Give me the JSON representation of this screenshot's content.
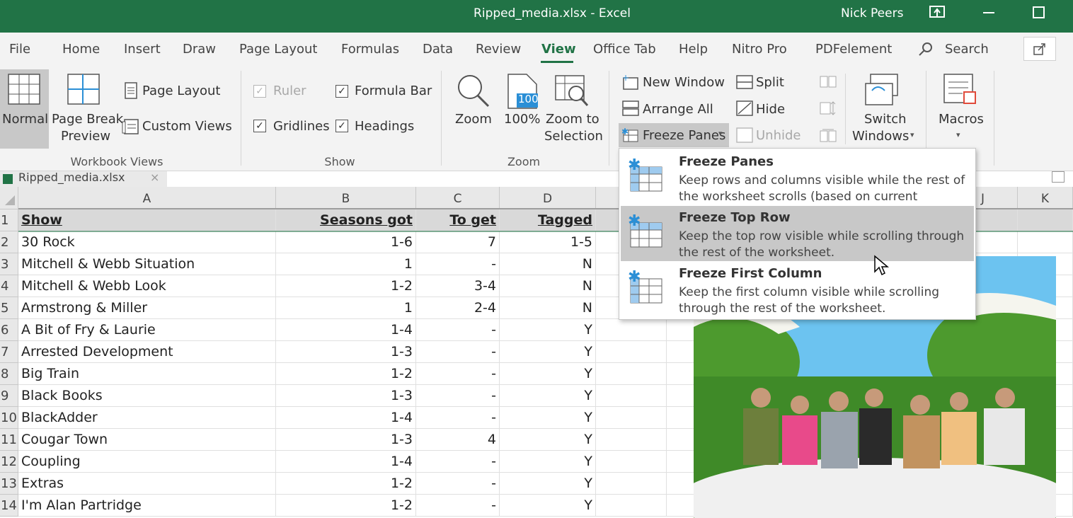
{
  "titlebar": {
    "title": "Ripped_media.xlsx - Excel",
    "user": "Nick Peers"
  },
  "menu": {
    "tabs": [
      "File",
      "Home",
      "Insert",
      "Draw",
      "Page Layout",
      "Formulas",
      "Data",
      "Review",
      "View",
      "Office Tab",
      "Help",
      "Nitro Pro",
      "PDFelement"
    ],
    "active": "View",
    "search": "Search"
  },
  "ribbon": {
    "workbook_views": {
      "normal": "Normal",
      "page_break_1": "Page Break",
      "page_break_2": "Preview",
      "page_layout": "Page Layout",
      "custom_views": "Custom Views",
      "group": "Workbook Views"
    },
    "show": {
      "ruler": "Ruler",
      "formula_bar": "Formula Bar",
      "gridlines": "Gridlines",
      "headings": "Headings",
      "group": "Show"
    },
    "zoom": {
      "zoom": "Zoom",
      "hundred": "100%",
      "hundred_icon": "100",
      "zoom_sel_1": "Zoom to",
      "zoom_sel_2": "Selection",
      "group": "Zoom"
    },
    "window": {
      "new_window": "New Window",
      "arrange_all": "Arrange All",
      "freeze_panes": "Freeze Panes",
      "split": "Split",
      "hide": "Hide",
      "unhide": "Unhide",
      "switch_1": "Switch",
      "switch_2": "Windows",
      "group_partial": "s"
    },
    "macros": {
      "label": "Macros"
    }
  },
  "doc_tab": "Ripped_media.xlsx",
  "sheet": {
    "columns": [
      "A",
      "B",
      "C",
      "D",
      "J",
      "K"
    ],
    "rows": [
      {
        "n": "1",
        "show": "Show",
        "seasons": "Seasons got",
        "to_get": "To get",
        "tagged": "Tagged"
      },
      {
        "n": "2",
        "show": "30 Rock",
        "seasons": "1-6",
        "to_get": "7",
        "tagged": "1-5"
      },
      {
        "n": "3",
        "show": "Mitchell & Webb Situation",
        "seasons": "1",
        "to_get": "-",
        "tagged": "N"
      },
      {
        "n": "4",
        "show": "Mitchell & Webb Look",
        "seasons": "1-2",
        "to_get": "3-4",
        "tagged": "N"
      },
      {
        "n": "5",
        "show": "Armstrong & Miller",
        "seasons": "1",
        "to_get": "2-4",
        "tagged": "N"
      },
      {
        "n": "6",
        "show": "A Bit of Fry & Laurie",
        "seasons": "1-4",
        "to_get": "-",
        "tagged": "Y"
      },
      {
        "n": "7",
        "show": "Arrested Development",
        "seasons": "1-3",
        "to_get": "-",
        "tagged": "Y"
      },
      {
        "n": "8",
        "show": "Big Train",
        "seasons": "1-2",
        "to_get": "-",
        "tagged": "Y"
      },
      {
        "n": "9",
        "show": "Black Books",
        "seasons": "1-3",
        "to_get": "-",
        "tagged": "Y"
      },
      {
        "n": "10",
        "show": "BlackAdder",
        "seasons": "1-4",
        "to_get": "-",
        "tagged": "Y"
      },
      {
        "n": "11",
        "show": "Cougar Town",
        "seasons": "1-3",
        "to_get": "4",
        "tagged": "Y"
      },
      {
        "n": "12",
        "show": "Coupling",
        "seasons": "1-4",
        "to_get": "-",
        "tagged": "Y"
      },
      {
        "n": "13",
        "show": "Extras",
        "seasons": "1-2",
        "to_get": "-",
        "tagged": "Y"
      },
      {
        "n": "14",
        "show": "I'm Alan Partridge",
        "seasons": "1-2",
        "to_get": "-",
        "tagged": "Y"
      }
    ]
  },
  "dropdown": {
    "items": [
      {
        "title": "Freeze Panes",
        "desc": "Keep rows and columns visible while the rest of the worksheet scrolls (based on current selection)."
      },
      {
        "title": "Freeze Top Row",
        "desc": "Keep the top row visible while scrolling through the rest of the worksheet."
      },
      {
        "title": "Freeze First Column",
        "desc": "Keep the first column visible while scrolling through the rest of the worksheet."
      }
    ],
    "highlighted_index": 1
  },
  "colors": {
    "excel_green": "#217346",
    "ribbon_bg": "#f3f3f3",
    "highlight": "#c8c8c8",
    "icon_blue": "#2b8fd6"
  }
}
